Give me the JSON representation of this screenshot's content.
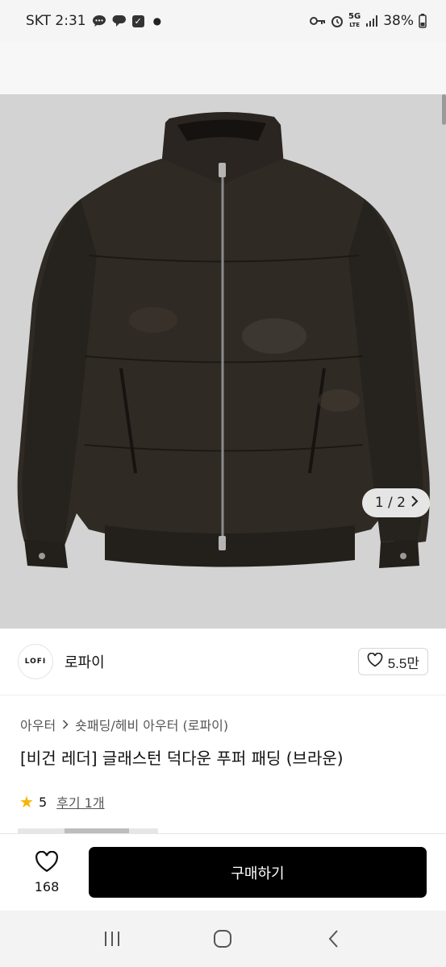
{
  "status_bar": {
    "carrier_time": "SKT 2:31",
    "battery": "38%",
    "network": "5G",
    "network_sub": "LTE",
    "left_icons": [
      "chat-bubble-icon",
      "messenger-icon",
      "check-box-icon",
      "dot-icon"
    ],
    "right_icons": [
      "key-icon",
      "alarm-icon",
      "signal-icon",
      "battery-icon"
    ]
  },
  "gallery": {
    "counter": "1 / 2",
    "image_alt": "brown leather puffer jacket product photo",
    "background_color": "#d3d3d3",
    "jacket_color": "#2f2a24"
  },
  "seller": {
    "logo_text": "LOFI",
    "name": "로파이",
    "likes": "5.5만"
  },
  "product": {
    "category_main": "아우터",
    "category_sub": "숏패딩/헤비 아우터 (로파이)",
    "title": "[비건 레더] 글래스턴 덕다운 푸퍼 패딩 (브라운)",
    "rating": "5",
    "reviews": "후기 1개"
  },
  "action_bar": {
    "wish_count": "168",
    "buy_label": "구매하기"
  },
  "colors": {
    "accent": "#000000",
    "star": "#f7b500"
  }
}
